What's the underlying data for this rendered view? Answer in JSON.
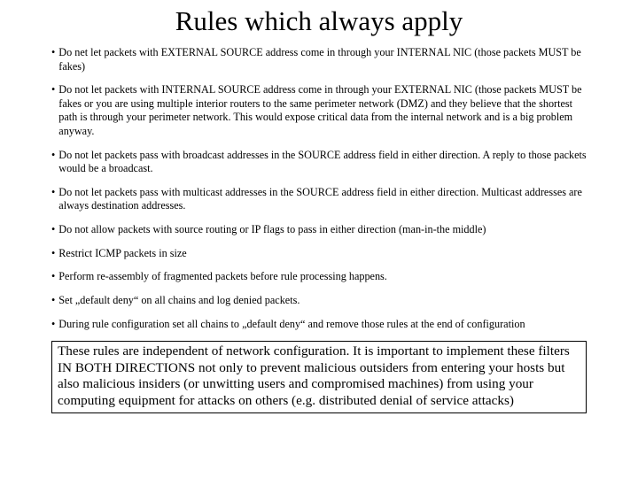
{
  "title": "Rules which always apply",
  "bullets": [
    "Do net let packets with EXTERNAL  SOURCE address come in through your INTERNAL NIC (those packets MUST be fakes)",
    "Do not let packets with INTERNAL SOURCE address come in through your EXTERNAL NIC (those packets MUST be fakes or you are using multiple interior routers to the same perimeter network (DMZ) and they believe that the shortest path is through your perimeter network. This would expose critical data from the internal network and is a big problem anyway.",
    "Do not let packets pass with broadcast addresses in the SOURCE address field in either direction. A reply to those packets would be a broadcast.",
    "Do not let packets pass with multicast addresses in the SOURCE address field in either direction. Multicast addresses are always destination addresses.",
    "Do not allow packets with source routing or IP flags to pass in either direction (man-in-the middle)",
    "Restrict ICMP packets in size",
    "Perform re-assembly of fragmented packets  before rule processing happens.",
    "Set „default deny“ on all chains and log denied packets.",
    "During rule configuration set all chains to „default deny“ and remove those rules at the end of configuration"
  ],
  "footer": "These rules are independent of network configuration. It is important to implement these filters IN BOTH DIRECTIONS not only to prevent malicious outsiders from entering your hosts but also malicious insiders (or unwitting users and compromised machines) from using your computing equipment for attacks on others (e.g. distributed denial of service attacks)"
}
